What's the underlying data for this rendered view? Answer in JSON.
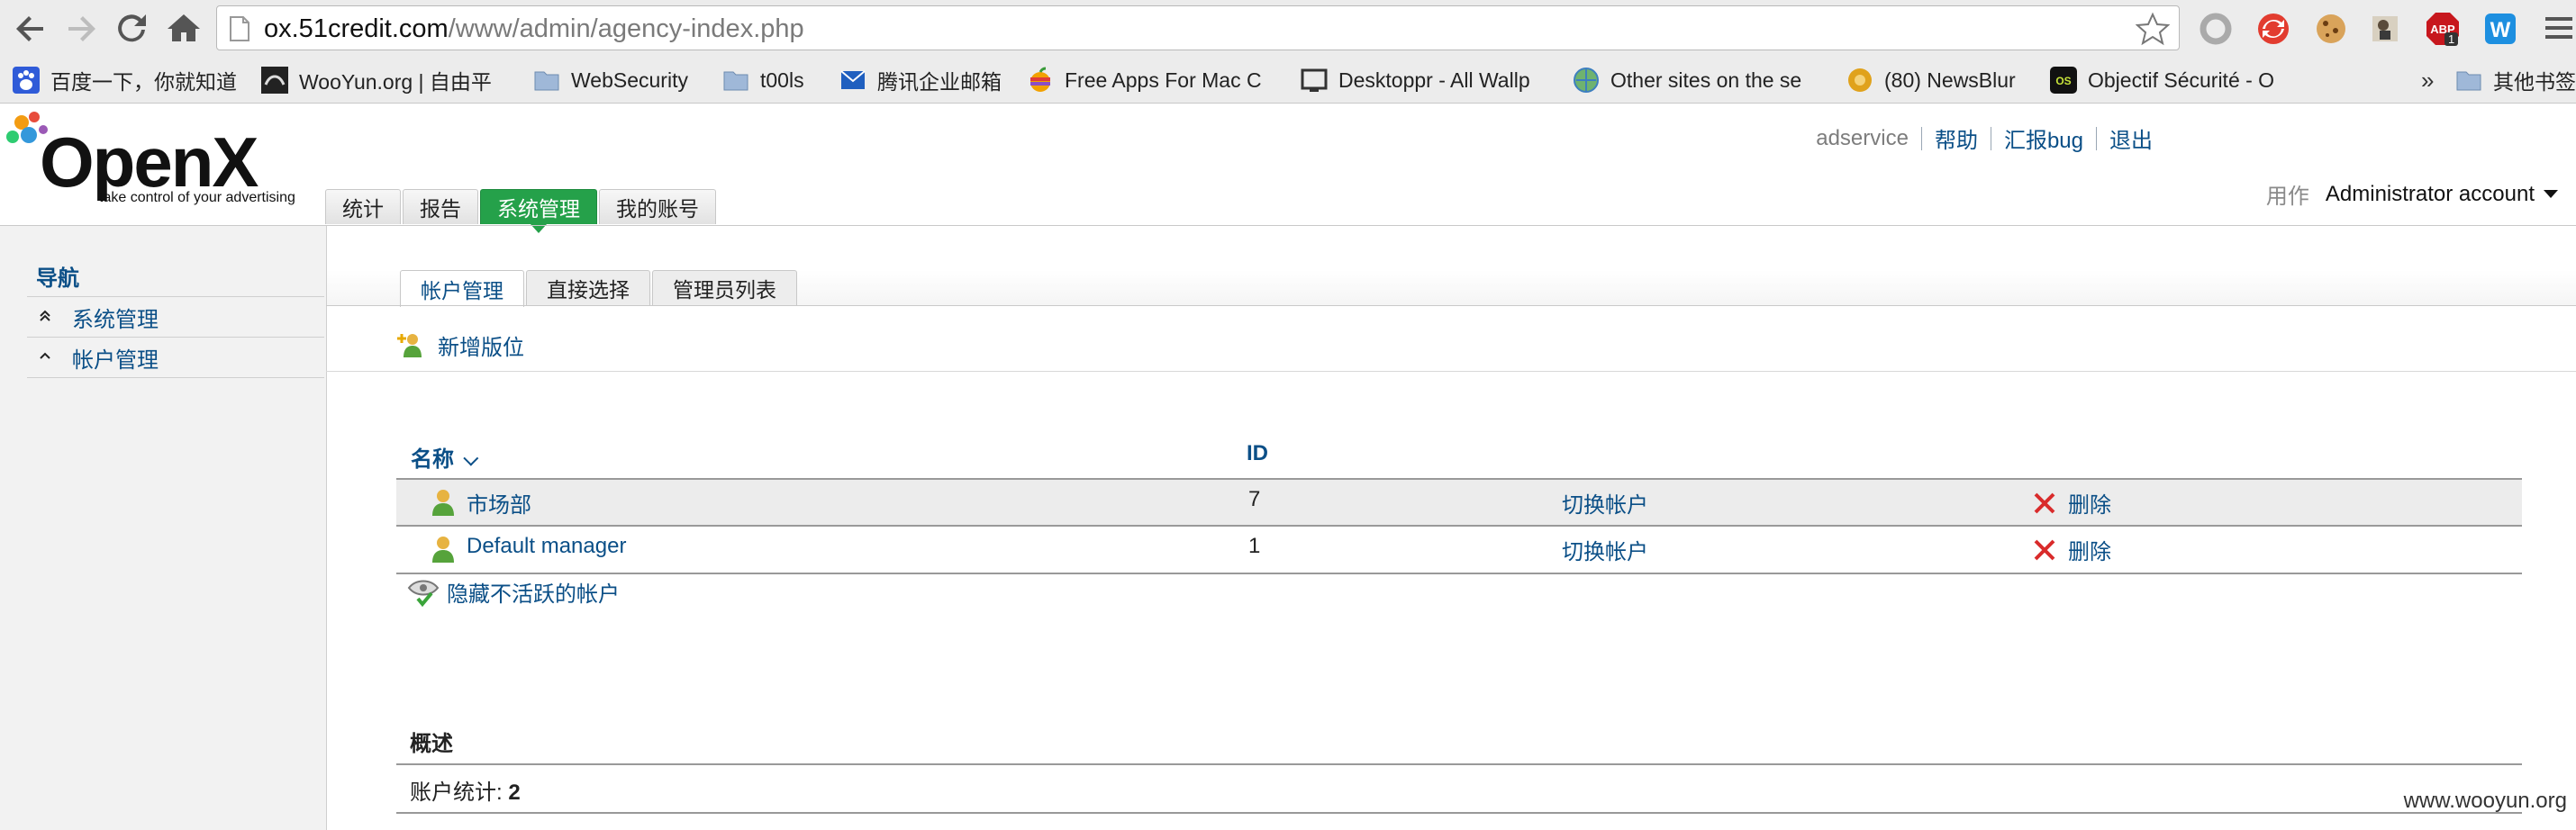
{
  "browser": {
    "url_host": "ox.51credit.com",
    "url_path": "/www/admin/agency-index.php",
    "bookmarks": [
      {
        "label": "百度一下，你就知道",
        "icon": "baidu-paw-icon"
      },
      {
        "label": "WooYun.org | 自由平",
        "icon": "wooyun-icon"
      },
      {
        "label": "WebSecurity",
        "icon": "folder-icon"
      },
      {
        "label": "t00ls",
        "icon": "folder-icon"
      },
      {
        "label": "腾讯企业邮箱",
        "icon": "tencent-mail-icon"
      },
      {
        "label": "Free Apps For Mac C",
        "icon": "apple-icon"
      },
      {
        "label": "Desktoppr - All Wallp",
        "icon": "desktoppr-icon"
      },
      {
        "label": "Other sites on the se",
        "icon": "globe-icon"
      },
      {
        "label": "(80) NewsBlur",
        "icon": "newsblur-icon"
      },
      {
        "label": "Objectif Sécurité - O",
        "icon": "os-icon"
      }
    ],
    "overflow": "»",
    "other_bookmarks": "其他书签",
    "abp_badge": "1"
  },
  "header": {
    "logo": "OpenX",
    "tagline": "take control of your advertising",
    "user": "adservice",
    "help": "帮助",
    "report_bug": "汇报bug",
    "logout": "退出",
    "acting_as_label": "用作",
    "acting_as_value": "Administrator account",
    "tabs": [
      {
        "label": "统计",
        "active": false
      },
      {
        "label": "报告",
        "active": false
      },
      {
        "label": "系统管理",
        "active": true
      },
      {
        "label": "我的账号",
        "active": false
      }
    ]
  },
  "sidebar": {
    "title": "导航",
    "items": [
      {
        "label": "系统管理",
        "arrow": "double-up"
      },
      {
        "label": "帐户管理",
        "arrow": "up"
      }
    ]
  },
  "content": {
    "subtabs": [
      {
        "label": "帐户管理",
        "active": true
      },
      {
        "label": "直接选择",
        "active": false
      },
      {
        "label": "管理员列表",
        "active": false
      }
    ],
    "add_link": "新增版位",
    "columns": {
      "name": "名称",
      "id": "ID"
    },
    "rows": [
      {
        "name": "市场部",
        "id": "7",
        "switch": "切换帐户",
        "delete": "删除"
      },
      {
        "name": "Default manager",
        "id": "1",
        "switch": "切换帐户",
        "delete": "删除"
      }
    ],
    "hide_inactive": "隐藏不活跃的帐户",
    "summary_title": "概述",
    "summary_label": "账户统计: ",
    "summary_count": "2"
  },
  "watermark": "www.wooyun.org",
  "colors": {
    "accent_green": "#25a14a",
    "link_blue": "#0b4f87",
    "delete_red": "#d92b2b"
  }
}
